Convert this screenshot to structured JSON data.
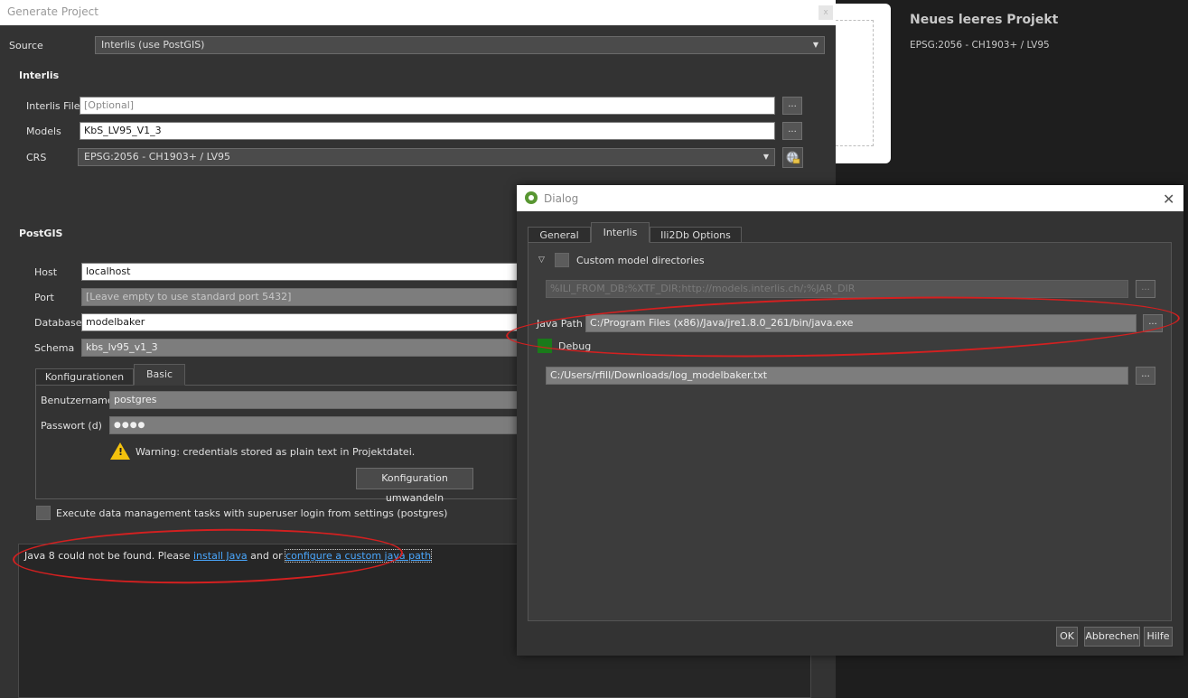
{
  "background": {
    "template_title": "Neues leeres Projekt",
    "template_crs": "EPSG:2056 - CH1903+ / LV95"
  },
  "main": {
    "window_title": "Generate Project",
    "close_glyph": "x",
    "source_label": "Source",
    "source_value": "Interlis (use PostGIS)",
    "interlis_header": "Interlis",
    "interlis_file_label": "Interlis File",
    "interlis_file_placeholder": "[Optional]",
    "models_label": "Models",
    "models_value": "KbS_LV95_V1_3",
    "crs_label": "CRS",
    "crs_value": "EPSG:2056 - CH1903+ / LV95",
    "browse_label": "...",
    "postgis_header": "PostGIS",
    "host_label": "Host",
    "host_value": "localhost",
    "port_label": "Port",
    "port_placeholder": "[Leave empty to use standard port 5432]",
    "database_label": "Database",
    "database_value": "modelbaker",
    "schema_label": "Schema",
    "schema_value": "kbs_lv95_v1_3",
    "tabs": [
      {
        "label": "Konfigurationen"
      },
      {
        "label": "Basic"
      }
    ],
    "username_label": "Benutzername",
    "username_value": "postgres",
    "password_label": "Passwort (d)",
    "password_value": "●●●●",
    "warning_text": "Warning: credentials stored as plain text in Projektdatei.",
    "convert_button": "Konfiguration umwandeln",
    "superuser_label": "Execute data management tasks with superuser login from settings (postgres)",
    "message": {
      "prefix": "Java 8 could not be found. Please",
      "link1": "install Java",
      "middle": "and or",
      "link2": "configure a custom java path"
    }
  },
  "dialog": {
    "title": "Dialog",
    "close_glyph": "✕",
    "tabs": [
      {
        "label": "General"
      },
      {
        "label": "Interlis"
      },
      {
        "label": "Ili2Db Options"
      }
    ],
    "custom_dirs_label": "Custom model directories",
    "custom_dirs_value": "%ILI_FROM_DB;%XTF_DIR;http://models.interlis.ch/;%JAR_DIR",
    "java_path_label": "Java Path",
    "java_path_value": "C:/Program Files (x86)/Java/jre1.8.0_261/bin/java.exe",
    "debug_label": "Debug",
    "log_path_value": "C:/Users/rfill/Downloads/log_modelbaker.txt",
    "browse_label": "...",
    "ok_button": "OK",
    "cancel_button": "Abbrechen",
    "help_button": "Hilfe"
  },
  "colors": {
    "annotation_red": "#d42020",
    "link_blue": "#4aa8ff",
    "debug_checked_green": "#1a7a1a",
    "warning_yellow": "#f4c20d"
  }
}
